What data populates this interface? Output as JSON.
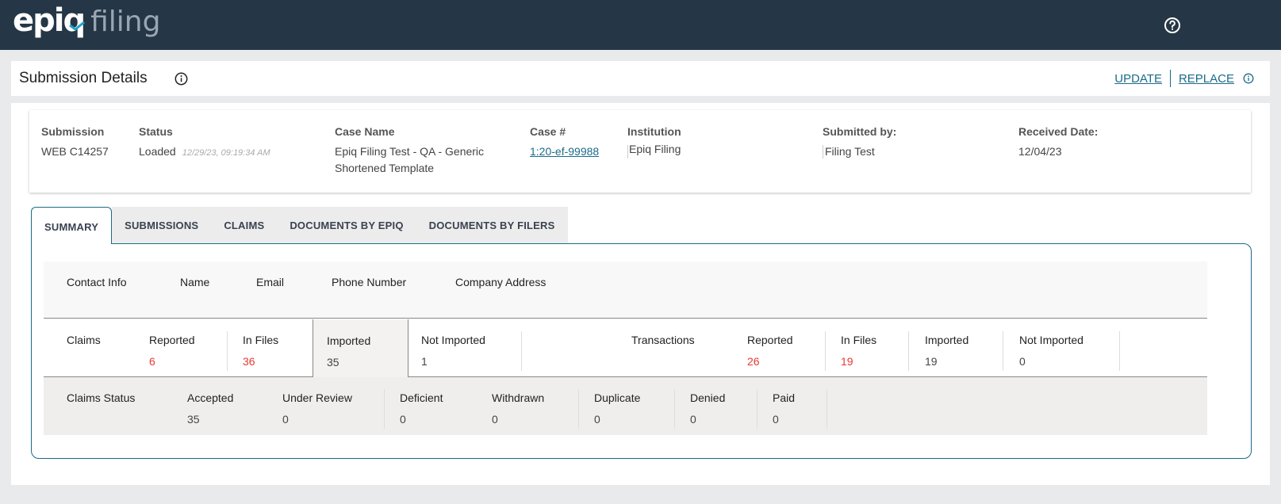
{
  "header": {
    "logo_main": "epiq",
    "logo_sub": "filing",
    "help_icon": "help-circle-icon"
  },
  "title_bar": {
    "title": "Submission Details",
    "update_label": "UPDATE",
    "replace_label": "REPLACE"
  },
  "submission": {
    "submission_label": "Submission",
    "submission_value": "WEB C14257",
    "status_label": "Status",
    "status_value": "Loaded",
    "status_timestamp": "12/29/23, 09:19:34 AM",
    "case_name_label": "Case Name",
    "case_name_line1": "Epiq Filing Test - QA - Generic",
    "case_name_line2": "Shortened Template",
    "case_num_label": "Case #",
    "case_num_value": "1:20-ef-99988",
    "institution_label": "Institution",
    "institution_value": "Epiq Filing",
    "submitted_by_label": "Submitted by:",
    "submitted_by_value": "Filing Test",
    "received_date_label": "Received Date:",
    "received_date_value": "12/04/23"
  },
  "tabs": [
    {
      "label": "SUMMARY",
      "active": true
    },
    {
      "label": "SUBMISSIONS"
    },
    {
      "label": "CLAIMS"
    },
    {
      "label": "DOCUMENTS BY EPIQ"
    },
    {
      "label": "DOCUMENTS BY FILERS"
    }
  ],
  "contact": {
    "title": "Contact Info",
    "name": "Name",
    "email": "Email",
    "phone": "Phone Number",
    "address": "Company Address"
  },
  "claims": {
    "title": "Claims",
    "reported_label": "Reported",
    "reported_value": "6",
    "in_files_label": "In Files",
    "in_files_value": "36",
    "imported_label": "Imported",
    "imported_value": "35",
    "not_imported_label": "Not Imported",
    "not_imported_value": "1"
  },
  "transactions": {
    "title": "Transactions",
    "reported_label": "Reported",
    "reported_value": "26",
    "in_files_label": "In Files",
    "in_files_value": "19",
    "imported_label": "Imported",
    "imported_value": "19",
    "not_imported_label": "Not Imported",
    "not_imported_value": "0"
  },
  "claims_status": {
    "title": "Claims Status",
    "items": [
      {
        "label": "Accepted",
        "value": "35"
      },
      {
        "label": "Under Review",
        "value": "0"
      },
      {
        "label": "Deficient",
        "value": "0"
      },
      {
        "label": "Withdrawn",
        "value": "0"
      },
      {
        "label": "Duplicate",
        "value": "0"
      },
      {
        "label": "Denied",
        "value": "0"
      },
      {
        "label": "Paid",
        "value": "0"
      }
    ]
  },
  "colors": {
    "header_bg": "#253746",
    "accent": "#1a6b8a",
    "alert": "#e53935"
  }
}
